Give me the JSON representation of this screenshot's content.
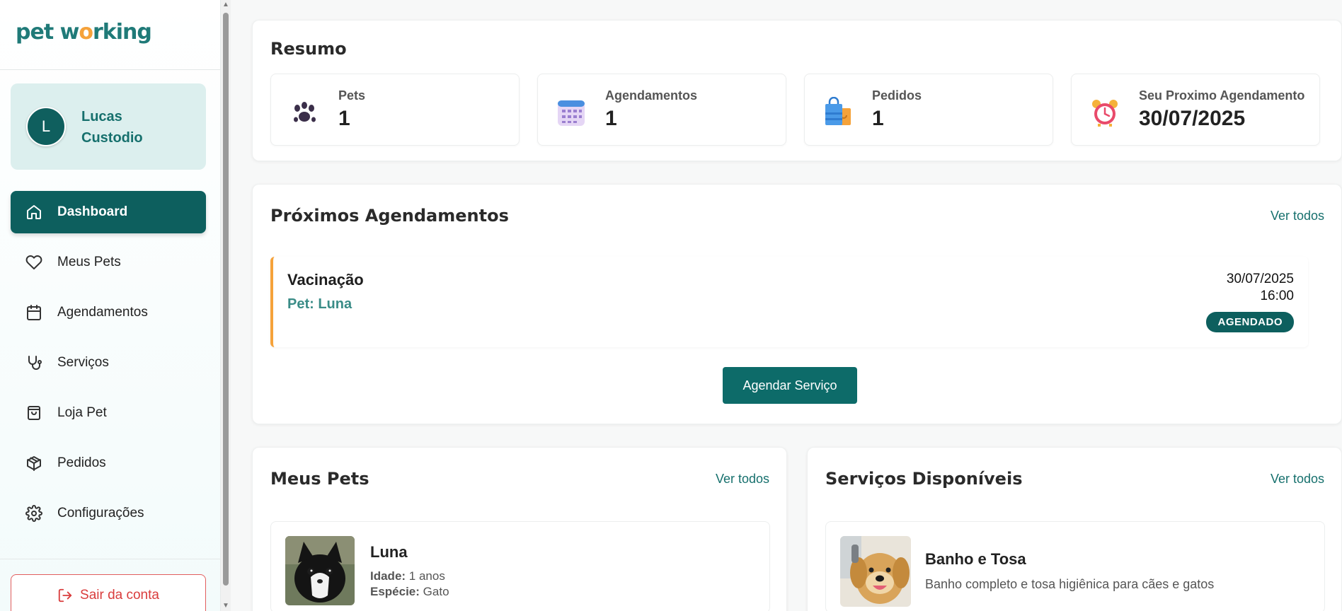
{
  "brand": {
    "logo_part1": "pet w",
    "logo_o": "o",
    "logo_part2": "rking"
  },
  "user": {
    "initial": "L",
    "name": "Lucas Custodio"
  },
  "nav": [
    {
      "label": "Dashboard",
      "icon": "home-icon",
      "active": true
    },
    {
      "label": "Meus Pets",
      "icon": "heart-icon"
    },
    {
      "label": "Agendamentos",
      "icon": "calendar-icon"
    },
    {
      "label": "Serviços",
      "icon": "stethoscope-icon"
    },
    {
      "label": "Loja Pet",
      "icon": "shopping-bag-icon"
    },
    {
      "label": "Pedidos",
      "icon": "package-icon"
    },
    {
      "label": "Configurações",
      "icon": "gear-icon"
    }
  ],
  "logout_label": "Sair da conta",
  "resumo": {
    "title": "Resumo",
    "stats": [
      {
        "label": "Pets",
        "value": "1",
        "icon": "paw-icon"
      },
      {
        "label": "Agendamentos",
        "value": "1",
        "icon": "calendar-icon"
      },
      {
        "label": "Pedidos",
        "value": "1",
        "icon": "shopping-bags-icon"
      },
      {
        "label": "Seu Proximo Agendamento",
        "value": "30/07/2025",
        "icon": "alarm-clock-icon"
      }
    ]
  },
  "proximos": {
    "title": "Próximos Agendamentos",
    "ver_todos": "Ver todos",
    "appointment": {
      "service": "Vacinação",
      "pet": "Pet: Luna",
      "date": "30/07/2025",
      "time": "16:00",
      "status": "AGENDADO"
    },
    "button": "Agendar Serviço"
  },
  "meus_pets": {
    "title": "Meus Pets",
    "ver_todos": "Ver todos",
    "pet": {
      "name": "Luna",
      "idade_label": "Idade:",
      "idade": "1 anos",
      "especie_label": "Espécie:",
      "especie": "Gato"
    }
  },
  "servicos": {
    "title": "Serviços Disponíveis",
    "ver_todos": "Ver todos",
    "service": {
      "name": "Banho e Tosa",
      "description": "Banho completo e tosa higiênica para cães e gatos"
    }
  },
  "colors": {
    "primary": "#0d5f5e",
    "accent": "#f5a23a",
    "danger": "#d93c3c"
  }
}
